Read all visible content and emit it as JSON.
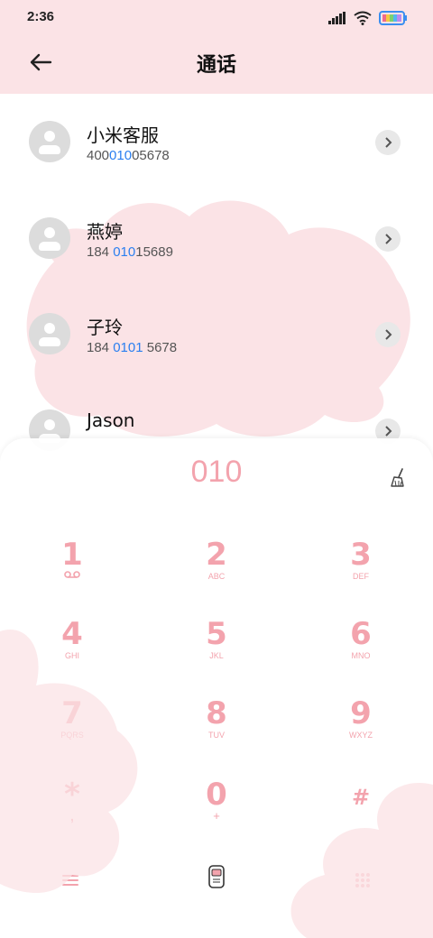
{
  "status_bar": {
    "time": "2:36"
  },
  "header": {
    "title": "通话"
  },
  "contacts": [
    {
      "name": "小米客服",
      "num_pre": "400",
      "num_hl": "010",
      "num_post": "05678"
    },
    {
      "name": "燕婷",
      "num_pre": "184 ",
      "num_hl": "010",
      "num_post": "15689"
    },
    {
      "name": "子玲",
      "num_pre": "184 ",
      "num_hl": "0101",
      "num_post": " 5678"
    },
    {
      "name": "Jason",
      "num_pre": "",
      "num_hl": "",
      "num_post": ""
    }
  ],
  "dialpad": {
    "display": "010",
    "keys": [
      {
        "digit": "1",
        "letters": ""
      },
      {
        "digit": "2",
        "letters": "ABC"
      },
      {
        "digit": "3",
        "letters": "DEF"
      },
      {
        "digit": "4",
        "letters": "GHI"
      },
      {
        "digit": "5",
        "letters": "JKL"
      },
      {
        "digit": "6",
        "letters": "MNO"
      },
      {
        "digit": "7",
        "letters": "PQRS"
      },
      {
        "digit": "8",
        "letters": "TUV"
      },
      {
        "digit": "9",
        "letters": "WXYZ"
      },
      {
        "digit": "*",
        "letters": ","
      },
      {
        "digit": "0",
        "letters": "+"
      },
      {
        "digit": "#",
        "letters": ""
      }
    ]
  },
  "colors": {
    "accent": "#f3a3ad",
    "header_bg": "#fbe3e6",
    "highlight": "#2a7ff0"
  }
}
